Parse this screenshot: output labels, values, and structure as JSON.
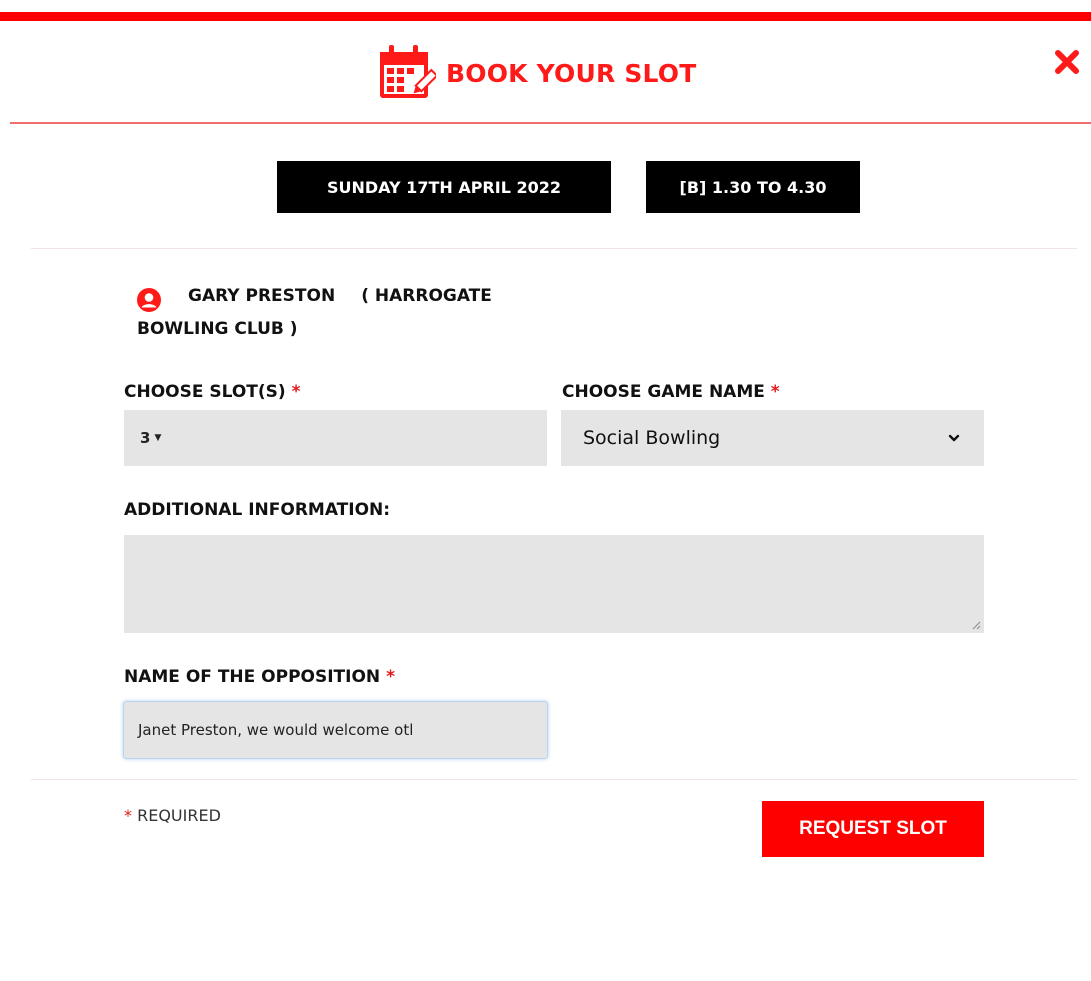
{
  "header": {
    "title": "BOOK YOUR SLOT",
    "icon": "calendar-edit-icon",
    "close_icon": "close-icon",
    "accent_color": "#ff0000"
  },
  "slot_info": {
    "date": "SUNDAY 17TH APRIL 2022",
    "time": "[B] 1.30 TO 4.30"
  },
  "user": {
    "icon": "user-icon",
    "name": "GARY PRESTON",
    "club_part1": "( HARROGATE",
    "club_part2": "BOWLING CLUB )"
  },
  "form": {
    "slots": {
      "label": "CHOOSE SLOT(S)",
      "required_mark": "*",
      "value": "3"
    },
    "game_name": {
      "label": "CHOOSE GAME NAME",
      "required_mark": "*",
      "value": "Social Bowling"
    },
    "additional_info": {
      "label": "ADDITIONAL INFORMATION:",
      "value": ""
    },
    "opposition": {
      "label": "NAME OF THE OPPOSITION",
      "required_mark": "*",
      "value": "Janet Preston, we would welcome otl"
    }
  },
  "footer": {
    "required_mark": "*",
    "required_text": "REQUIRED",
    "submit_label": "REQUEST SLOT"
  }
}
